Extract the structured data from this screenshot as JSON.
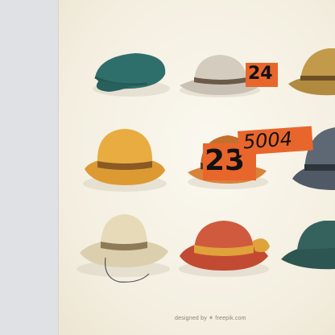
{
  "sidebar": {},
  "image": {
    "credit": "designed by ✶ freepik.com"
  },
  "hats": [
    {
      "name": "flat-cap",
      "color": "#2f6f6b"
    },
    {
      "name": "fedora-grey",
      "color": "#c9c2b4"
    },
    {
      "name": "fedora-tan",
      "color": "#b08a3e"
    },
    {
      "name": "bowler-yellow",
      "color": "#e3a33a"
    },
    {
      "name": "trilby-orange",
      "color": "#d9823a"
    },
    {
      "name": "fedora-dark-grey",
      "color": "#4f5a66"
    },
    {
      "name": "sun-hat-beige",
      "color": "#dccfae"
    },
    {
      "name": "cloche-red",
      "color": "#c24a32"
    },
    {
      "name": "bucket-teal",
      "color": "#2d5552"
    }
  ],
  "labels": [
    {
      "id": "tag-24",
      "text": "24"
    },
    {
      "id": "tag-23",
      "text": "23"
    },
    {
      "id": "tag-5004",
      "text": "5004"
    }
  ],
  "colors": {
    "tag_bg": "#e8662c",
    "panel_bg": "#e0e1e4",
    "canvas_bg": "#f5f0e4"
  }
}
